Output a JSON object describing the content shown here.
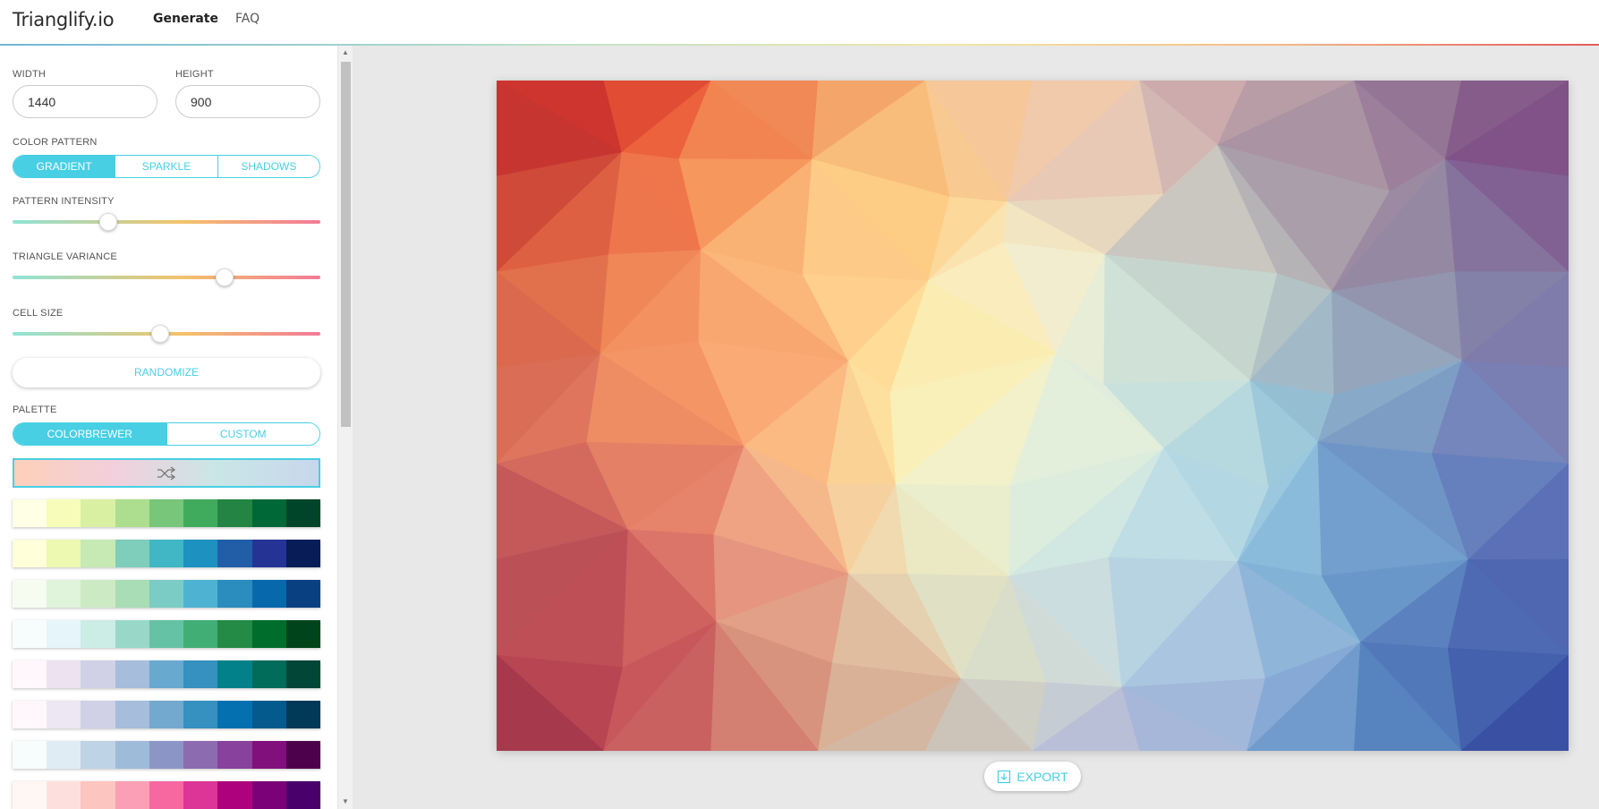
{
  "header": {
    "brand": "Trianglify.io",
    "nav": [
      {
        "label": "Generate",
        "active": true
      },
      {
        "label": "FAQ",
        "active": false
      }
    ]
  },
  "sidebar": {
    "width_label": "WIDTH",
    "width_value": "1440",
    "height_label": "HEIGHT",
    "height_value": "900",
    "color_pattern_label": "COLOR PATTERN",
    "color_pattern_options": [
      "GRADIENT",
      "SPARKLE",
      "SHADOWS"
    ],
    "color_pattern_selected": "GRADIENT",
    "pattern_intensity_label": "PATTERN INTENSITY",
    "pattern_intensity_level": 0.31,
    "triangle_variance_label": "TRIANGLE VARIANCE",
    "triangle_variance_level": 0.69,
    "cell_size_label": "CELL SIZE",
    "cell_size_level": 0.48,
    "randomize_label": "RANDOMIZE",
    "palette_label": "PALETTE",
    "palette_options": [
      "COLORBREWER",
      "CUSTOM"
    ],
    "palette_selected": "COLORBREWER",
    "current_palette_icon": "shuffle-icon",
    "current_palette_colors": [
      "#fdd0b9",
      "#f2d0dc",
      "#c9e6e6",
      "#c8d7ec"
    ],
    "palettes": [
      [
        "#ffffe5",
        "#f7fcb9",
        "#d9f0a3",
        "#addd8e",
        "#78c679",
        "#41ab5d",
        "#238443",
        "#006837",
        "#004529"
      ],
      [
        "#ffffd9",
        "#edf8b1",
        "#c7e9b4",
        "#7fcdbb",
        "#41b6c4",
        "#1d91c0",
        "#225ea8",
        "#253494",
        "#081d58"
      ],
      [
        "#f7fcf0",
        "#e0f3db",
        "#ccebc5",
        "#a8ddb5",
        "#7bccc4",
        "#4eb3d3",
        "#2b8cbe",
        "#0868ac",
        "#084081"
      ],
      [
        "#f7fcfd",
        "#e5f5f9",
        "#ccece6",
        "#99d8c9",
        "#66c2a4",
        "#41ae76",
        "#238b45",
        "#006d2c",
        "#00441b"
      ],
      [
        "#fff7fb",
        "#ece2f0",
        "#d0d1e6",
        "#a6bddb",
        "#67a9cf",
        "#3690c0",
        "#02818a",
        "#016c59",
        "#014636"
      ],
      [
        "#fff7fb",
        "#ece7f2",
        "#d0d1e6",
        "#a6bddb",
        "#74a9cf",
        "#3690c0",
        "#0570b0",
        "#045a8d",
        "#023858"
      ],
      [
        "#f7fcfd",
        "#e0ecf4",
        "#bfd3e6",
        "#9ebcda",
        "#8c96c6",
        "#8c6bb1",
        "#88419d",
        "#810f7c",
        "#4d004b"
      ],
      [
        "#fff7f3",
        "#fde0dd",
        "#fcc5c0",
        "#fa9fb5",
        "#f768a1",
        "#dd3497",
        "#ae017e",
        "#7a0177",
        "#49006a"
      ]
    ]
  },
  "export": {
    "label": "EXPORT",
    "icon": "download-icon"
  },
  "colors": {
    "accent": "#48cfe4"
  },
  "preview": {
    "grid": [
      [
        "#b01428",
        "#d2382c",
        "#e85a3a",
        "#ee8a52",
        "#f2b07a",
        "#f4c8a0",
        "#e8b8b0",
        "#c8a4aa",
        "#a88a9e",
        "#8c6a90",
        "#7a3f7c"
      ],
      [
        "#c03a36",
        "#e65236",
        "#f27a48",
        "#fbb872",
        "#fecf86",
        "#f8dcb0",
        "#d8c6be",
        "#b8a6aa",
        "#9f8aa0",
        "#8a6a92",
        "#7c4c8a"
      ],
      [
        "#c85240",
        "#ec7c50",
        "#f59460",
        "#fdc98a",
        "#ffe09a",
        "#fbeec4",
        "#e4e4d0",
        "#c0cbc4",
        "#a7a9b4",
        "#8d84a4",
        "#7c6ca0"
      ],
      [
        "#d66650",
        "#ef8456",
        "#f89c6c",
        "#ffc584",
        "#fff0a6",
        "#f3f6d6",
        "#ddecdc",
        "#aed2d8",
        "#90b3ca",
        "#8493b6",
        "#7c74ac"
      ],
      [
        "#c85c58",
        "#e48066",
        "#f6a070",
        "#f8c88e",
        "#faeab0",
        "#e8f2d8",
        "#cfe6e2",
        "#a6d4e4",
        "#84b6d6",
        "#6f8ec4",
        "#6a72b8"
      ],
      [
        "#b8505a",
        "#d0605c",
        "#e88876",
        "#f0c0a0",
        "#e8e4bc",
        "#e0eedc",
        "#c4e2e6",
        "#a6cfe4",
        "#78acd4",
        "#5a7cbc",
        "#5062b0"
      ],
      [
        "#a8404e",
        "#c44e58",
        "#d8786a",
        "#dca88c",
        "#d8d0b4",
        "#d4dcd0",
        "#bcc8dc",
        "#9cb8dc",
        "#6c9ccc",
        "#4a6cb4",
        "#4256a6"
      ],
      [
        "#962c48",
        "#b84050",
        "#cc6a66",
        "#d49a86",
        "#ccbcac",
        "#c2c0cc",
        "#aeb6da",
        "#8ca8d8",
        "#5c8cc4",
        "#3e62ae",
        "#2e3c96"
      ]
    ]
  }
}
